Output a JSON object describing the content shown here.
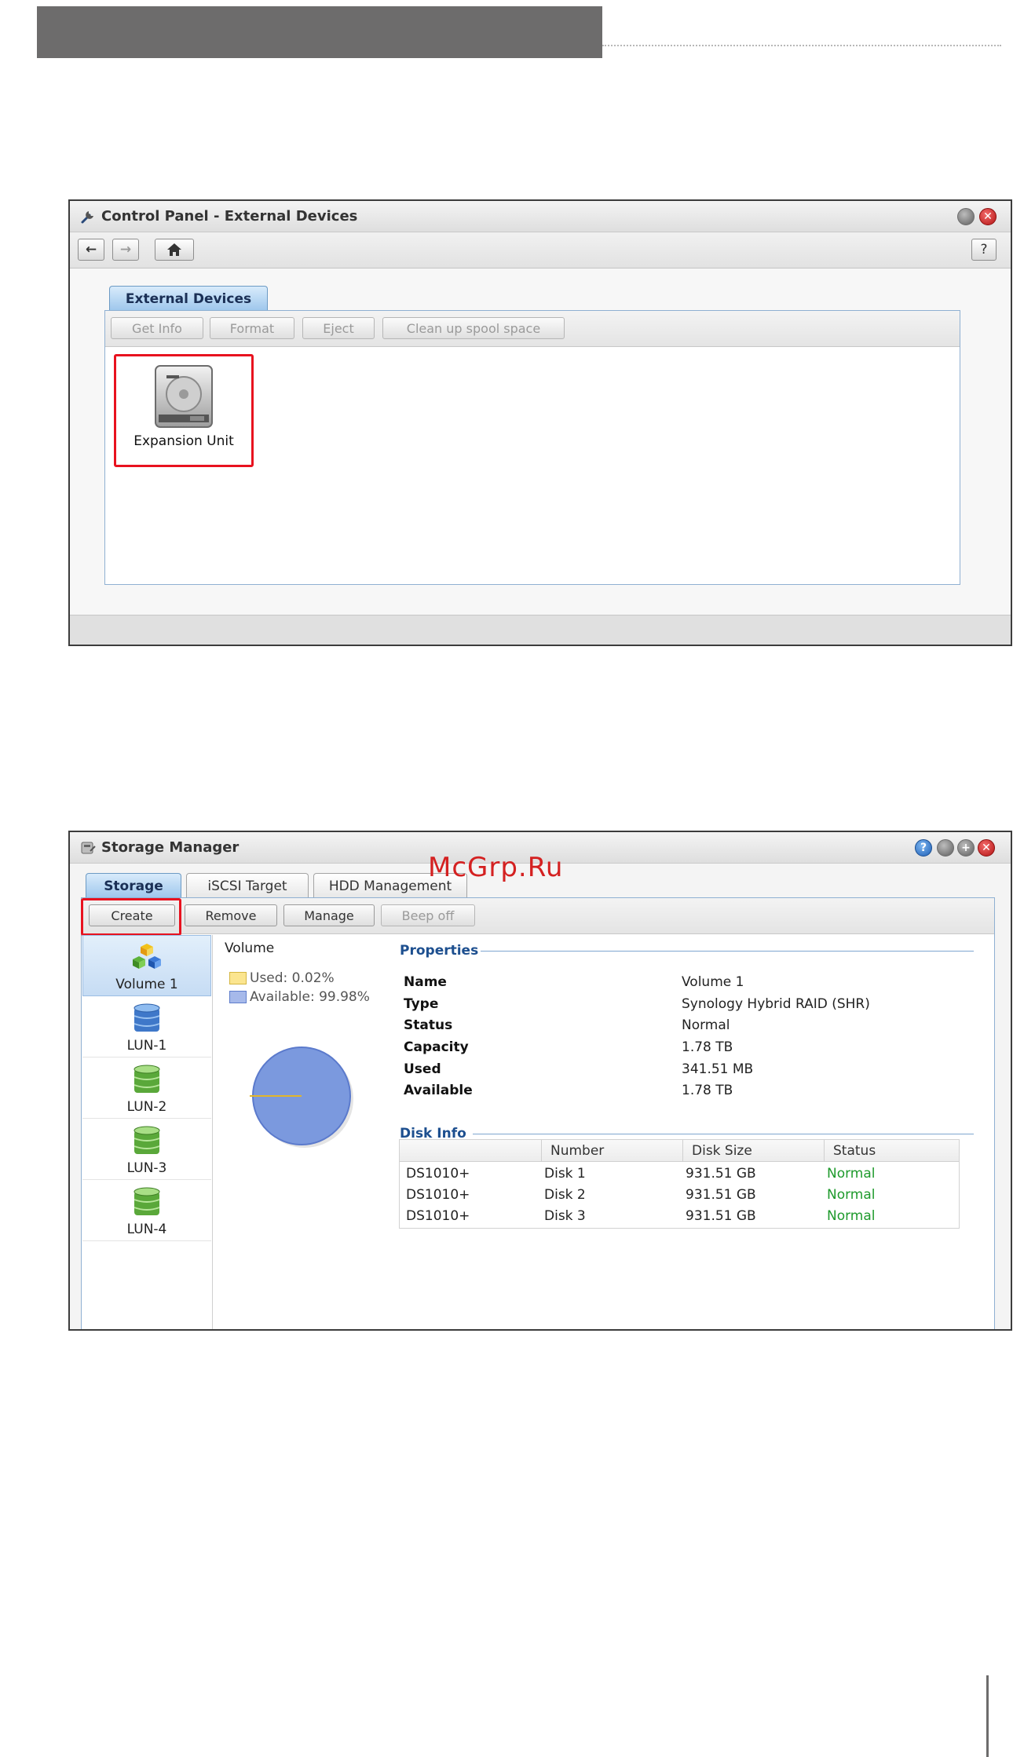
{
  "watermark": "McGrp.Ru",
  "colors": {
    "header_bar": "#6d6c6c",
    "accent_blue": "#1d4f8f",
    "highlight_red": "#e8121f",
    "status_ok": "#1e9a2c",
    "pie_available": "#7b99de",
    "pie_used": "#f5d25a"
  },
  "window1": {
    "title": "Control Panel - External Devices",
    "title_icon": "wrench-icon",
    "nav": {
      "back_icon": "arrow-left-icon",
      "forward_icon": "arrow-right-icon",
      "home_icon": "home-icon",
      "help_label": "?"
    },
    "tab": "External Devices",
    "buttons": [
      "Get Info",
      "Format",
      "Eject",
      "Clean up spool space"
    ],
    "device": {
      "label": "Expansion Unit",
      "icon": "hard-drive-icon"
    }
  },
  "window2": {
    "title": "Storage Manager",
    "title_icon": "storage-icon",
    "tabs": [
      "Storage",
      "iSCSI Target",
      "HDD Management"
    ],
    "buttons": [
      "Create",
      "Remove",
      "Manage",
      "Beep off"
    ],
    "sidebar": [
      {
        "label": "Volume 1",
        "icon": "volume-cubes-icon"
      },
      {
        "label": "LUN-1",
        "icon": "database-blue-icon"
      },
      {
        "label": "LUN-2",
        "icon": "database-green-icon"
      },
      {
        "label": "LUN-3",
        "icon": "database-green-icon"
      },
      {
        "label": "LUN-4",
        "icon": "database-green-icon"
      }
    ],
    "volume_heading": "Volume",
    "legend": {
      "used": "Used: 0.02%",
      "available": "Available: 99.98%"
    },
    "usage_fraction": {
      "used": 0.0002,
      "available": 0.9998
    },
    "properties_title": "Properties",
    "properties": [
      {
        "label": "Name",
        "value": "Volume 1"
      },
      {
        "label": "Type",
        "value": "Synology Hybrid RAID (SHR)"
      },
      {
        "label": "Status",
        "value": "Normal"
      },
      {
        "label": "Capacity",
        "value": "1.78 TB"
      },
      {
        "label": "Used",
        "value": "341.51 MB"
      },
      {
        "label": "Available",
        "value": "1.78 TB"
      }
    ],
    "disk_info_title": "Disk Info",
    "disk_columns": [
      "",
      "Number",
      "Disk Size",
      "Status"
    ],
    "disks": [
      {
        "model": "DS1010+",
        "number": "Disk 1",
        "size": "931.51 GB",
        "status": "Normal"
      },
      {
        "model": "DS1010+",
        "number": "Disk 2",
        "size": "931.51 GB",
        "status": "Normal"
      },
      {
        "model": "DS1010+",
        "number": "Disk 3",
        "size": "931.51 GB",
        "status": "Normal"
      }
    ]
  }
}
